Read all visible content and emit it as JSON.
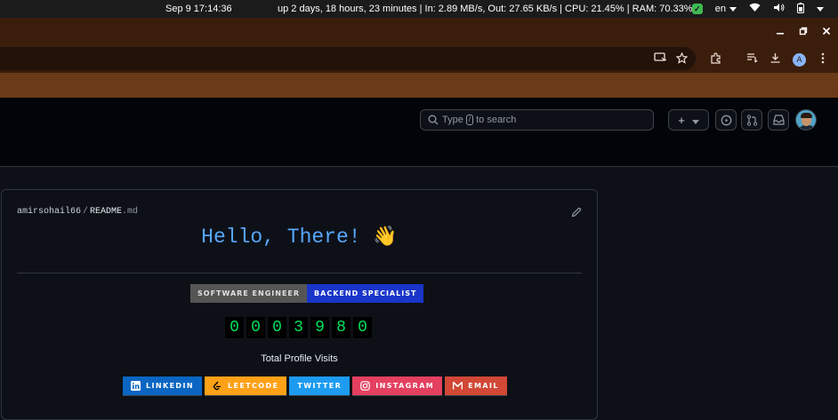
{
  "os_bar": {
    "clock": "Sep 9  17:14:36",
    "stats": "up 2 days, 18 hours, 23 minutes | In: 2.89 MB/s, Out: 27.65 KB/s | CPU: 21.45% | RAM: 70.33%",
    "lang": "en"
  },
  "browser": {
    "profile_initial": "A"
  },
  "header": {
    "search_prefix": "Type",
    "search_key": "/",
    "search_suffix": "to search",
    "new_button": "+"
  },
  "readme": {
    "owner": "amirsohail66",
    "separator": "/",
    "file_name": "README",
    "file_ext": ".md",
    "heading": "Hello, There!",
    "wave_emoji": "👋",
    "badges": [
      {
        "label": "SOFTWARE ENGINEER",
        "color": "#555555"
      },
      {
        "label": "BACKEND SPECIALIST",
        "color": "#1a35c9"
      }
    ],
    "visit_digits": [
      "0",
      "0",
      "0",
      "3",
      "9",
      "8",
      "0"
    ],
    "visits_label": "Total Profile Visits",
    "social": [
      {
        "label": "LINKEDIN",
        "color": "#0a66c2",
        "icon": "linkedin-icon"
      },
      {
        "label": "LEETCODE",
        "color": "#ffa116",
        "icon": "leetcode-icon"
      },
      {
        "label": "TWITTER",
        "color": "#1d9bf0",
        "icon": "twitter-icon"
      },
      {
        "label": "INSTAGRAM",
        "color": "#e4405f",
        "icon": "instagram-icon"
      },
      {
        "label": "EMAIL",
        "color": "#d14836",
        "icon": "email-icon"
      }
    ]
  }
}
